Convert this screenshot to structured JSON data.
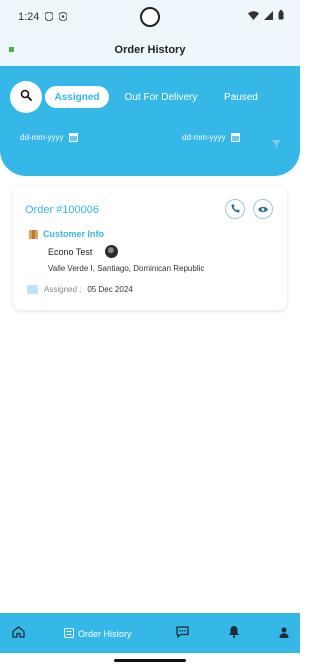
{
  "status_bar": {
    "time": "1:24",
    "icons_left": [
      "shield-icon",
      "vpn-icon"
    ],
    "icons_right": [
      "wifi-icon",
      "signal-icon",
      "battery-icon"
    ]
  },
  "app_bar": {
    "title": "Order History",
    "logo_icon": "app-logo-icon"
  },
  "tabs": [
    {
      "label": "Assigned",
      "active": true
    },
    {
      "label": "Out For Delivery",
      "active": false
    },
    {
      "label": "Paused",
      "active": false
    }
  ],
  "filters": {
    "start_date_placeholder": "dd-mm-yyyy",
    "end_date_placeholder": "dd-mm-yyyy",
    "filter_icon": "filter-icon"
  },
  "orders": [
    {
      "order_label": "Order #100006",
      "section_label": "Customer Info",
      "customer_name": "Econo Test",
      "address": "Valle Verde I, Santiago, Dominican Republic",
      "assigned_label": "Assigned :",
      "assigned_date": "05 Dec 2024"
    }
  ],
  "bottom_nav": {
    "items": [
      {
        "icon": "home-icon"
      },
      {
        "icon": "order-history-icon",
        "label": "Order History"
      },
      {
        "icon": "chat-icon"
      },
      {
        "icon": "bell-icon"
      },
      {
        "icon": "profile-icon"
      }
    ]
  },
  "colors": {
    "primary": "#35b7e8",
    "header_bg": "#eef7fb",
    "white": "#ffffff"
  }
}
